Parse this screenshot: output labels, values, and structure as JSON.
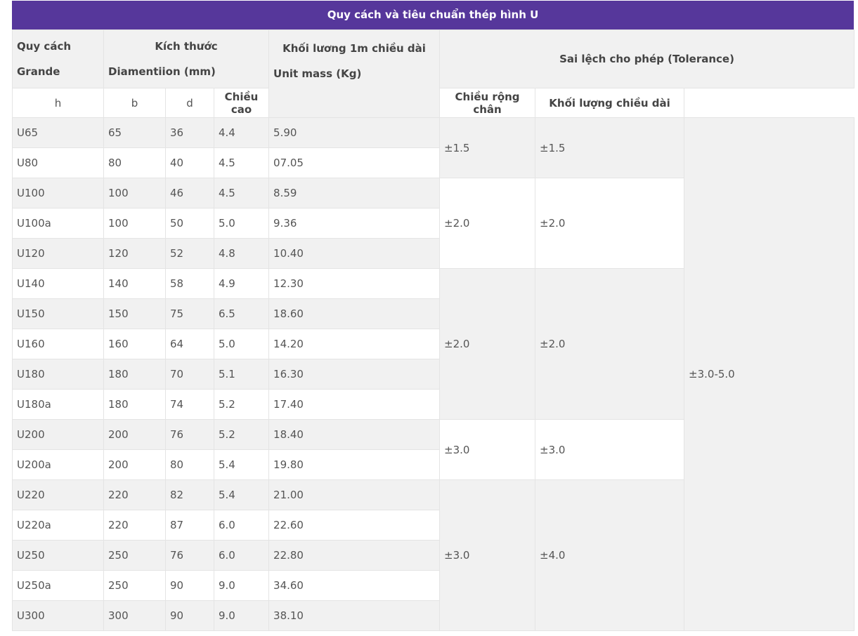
{
  "table": {
    "title": "Quy cách và tiêu chuẩn thép hình U",
    "headers": {
      "grade_line1": "Quy cách",
      "grade_line2": "Grande",
      "dim_line1": "Kích thước",
      "dim_line2": "Diamentiion (mm)",
      "mass_line1": "Khối lương 1m chiều dài",
      "mass_line2": "Unit mass (Kg)",
      "tolerance": "Sai lệch cho phép (Tolerance)",
      "h": "h",
      "b": "b",
      "d": "d",
      "tol_height": "Chiều cao",
      "tol_width": "Chiều rộng chân",
      "tol_mass": "Khối lượng chiều dài"
    },
    "rows": [
      {
        "grade": "U65",
        "h": "65",
        "b": "36",
        "d": "4.4",
        "mass": "5.90"
      },
      {
        "grade": "U80",
        "h": "80",
        "b": "40",
        "d": "4.5",
        "mass": "07.05"
      },
      {
        "grade": "U100",
        "h": "100",
        "b": "46",
        "d": "4.5",
        "mass": "8.59"
      },
      {
        "grade": "U100a",
        "h": "100",
        "b": "50",
        "d": "5.0",
        "mass": "9.36"
      },
      {
        "grade": "U120",
        "h": "120",
        "b": "52",
        "d": "4.8",
        "mass": "10.40"
      },
      {
        "grade": "U140",
        "h": "140",
        "b": "58",
        "d": "4.9",
        "mass": "12.30"
      },
      {
        "grade": "U150",
        "h": "150",
        "b": "75",
        "d": "6.5",
        "mass": "18.60"
      },
      {
        "grade": "U160",
        "h": "160",
        "b": "64",
        "d": "5.0",
        "mass": "14.20"
      },
      {
        "grade": "U180",
        "h": "180",
        "b": "70",
        "d": "5.1",
        "mass": "16.30"
      },
      {
        "grade": "U180a",
        "h": "180",
        "b": "74",
        "d": "5.2",
        "mass": "17.40"
      },
      {
        "grade": "U200",
        "h": "200",
        "b": "76",
        "d": "5.2",
        "mass": "18.40"
      },
      {
        "grade": "U200a",
        "h": "200",
        "b": "80",
        "d": "5.4",
        "mass": "19.80"
      },
      {
        "grade": "U220",
        "h": "220",
        "b": "82",
        "d": "5.4",
        "mass": "21.00"
      },
      {
        "grade": "U220a",
        "h": "220",
        "b": "87",
        "d": "6.0",
        "mass": "22.60"
      },
      {
        "grade": "U250",
        "h": "250",
        "b": "76",
        "d": "6.0",
        "mass": "22.80"
      },
      {
        "grade": "U250a",
        "h": "250",
        "b": "90",
        "d": "9.0",
        "mass": "34.60"
      },
      {
        "grade": "U300",
        "h": "300",
        "b": "90",
        "d": "9.0",
        "mass": "38.10"
      }
    ],
    "tolerance_groups": [
      {
        "height": "±1.5",
        "width": "±1.5"
      },
      {
        "height": "±2.0",
        "width": "±2.0"
      },
      {
        "height": "±2.0",
        "width": "±2.0"
      },
      {
        "height": "±3.0",
        "width": "±3.0"
      },
      {
        "height": "±3.0",
        "width": "±4.0"
      }
    ],
    "tolerance_mass": "±3.0-5.0"
  }
}
